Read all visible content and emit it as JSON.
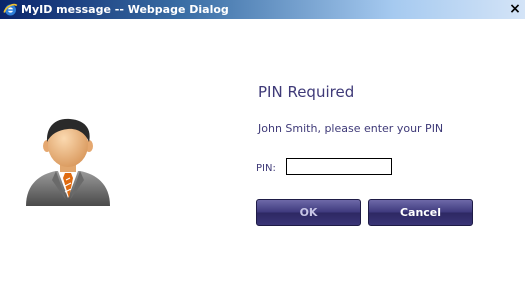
{
  "window": {
    "title": "MyID message -- Webpage Dialog",
    "close_label": "×",
    "app_icon": "ie-icon"
  },
  "dialog": {
    "heading": "PIN Required",
    "prompt": "John Smith, please enter your PIN",
    "pin_label": "PIN:",
    "pin_value": "",
    "ok_label": "OK",
    "cancel_label": "Cancel",
    "avatar_icon": "user-avatar-icon"
  },
  "colors": {
    "accent_text": "#3f3a78",
    "button": "#3f3a7e",
    "title_bar_start": "#0a246a",
    "title_bar_end": "#d4e4f7"
  }
}
